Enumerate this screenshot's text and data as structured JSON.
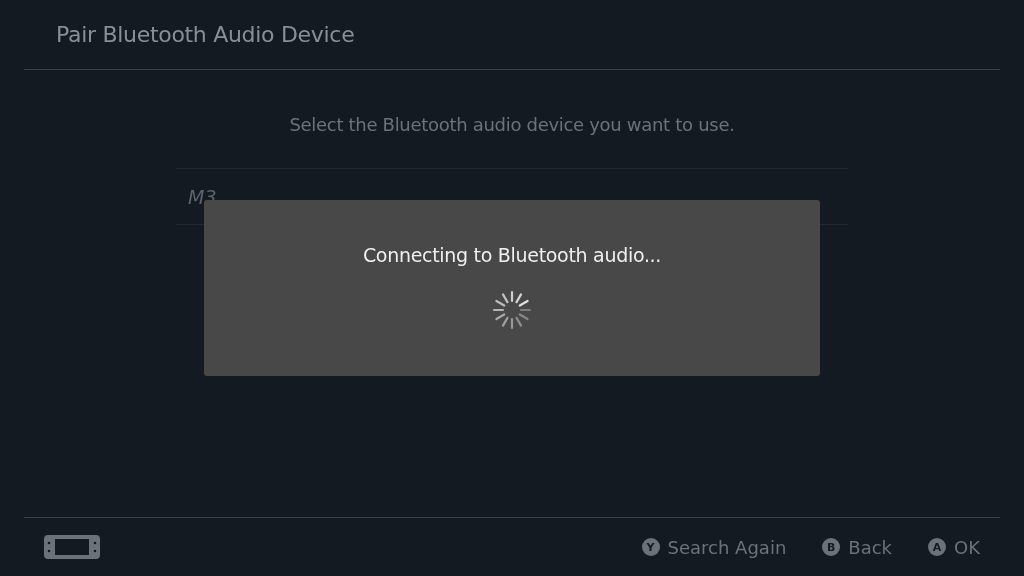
{
  "header": {
    "title": "Pair Bluetooth Audio Device"
  },
  "instruction": "Select the Bluetooth audio device you want to use.",
  "devices": [
    {
      "name": "M3"
    }
  ],
  "dialog": {
    "message": "Connecting to Bluetooth audio..."
  },
  "footer": {
    "hints": [
      {
        "key": "Y",
        "label": "Search Again"
      },
      {
        "key": "B",
        "label": "Back"
      },
      {
        "key": "A",
        "label": "OK"
      }
    ]
  }
}
